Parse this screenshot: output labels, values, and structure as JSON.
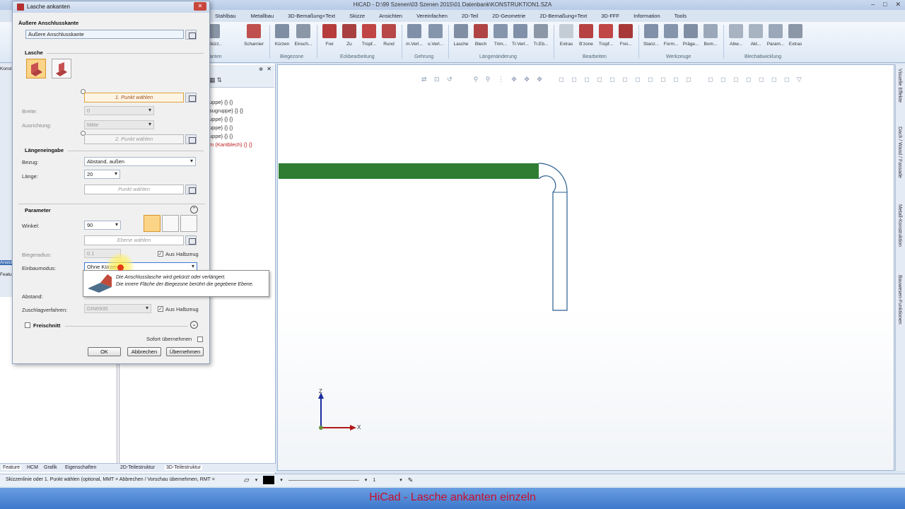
{
  "window": {
    "title": "HiCAD - D:\\99 Szenen\\03 Szenen 2015\\01 Datenbank\\KONSTRUKTION1.SZA",
    "controls": [
      "–",
      "□",
      "✕"
    ]
  },
  "ribbon": {
    "tabs": [
      "Stahlbau",
      "Metallbau",
      "3D-Bemaßung+Text",
      "Skizze",
      "Ansichten",
      "Vereinfachen",
      "2D-Teil",
      "2D-Geometrie",
      "2D-Bemaßung+Text",
      "3D-FFF",
      "Information",
      "Tools"
    ],
    "buttons": [
      "e.Skizz..",
      "Scharnier",
      "Kürzen",
      "Einsch...",
      "Frei",
      "Zu",
      "Tropf...",
      "Rund",
      "m.Verl...",
      "o.Verl...",
      "Lasche",
      "Blech",
      "Trim...",
      "Tr.Verl...",
      "Tr.Eb...",
      "Extras",
      "B'zone",
      "Tropf...",
      "Frei...",
      "Stanz...",
      "Form...",
      "Präge...",
      "Bom...",
      "Abw...",
      "Akt...",
      "Param...",
      "Extras"
    ],
    "groups": [
      "Biegezone",
      "Eckbearbeitung",
      "Gehrung",
      "Längenänderung",
      "Bearbeiten",
      "Werkzeuge",
      "Blechabwicklung"
    ],
    "partial_left": [
      "Gr",
      "anten"
    ]
  },
  "dialog": {
    "title": "Lasche ankanten",
    "sec_aussere": "Äußere Anschlusskante",
    "aussere_field": "Äußere Anschlusskante",
    "sec_lasche": "Lasche",
    "btn_punkt1": "1. Punkt wählen",
    "lbl_breite": "Breite:",
    "val_breite": "0",
    "lbl_ausrichtung": "Ausrichtung:",
    "val_ausrichtung": "Mitte",
    "btn_punkt2": "2. Punkt wählen",
    "sec_laengen": "Längeneingabe",
    "lbl_bezug": "Bezug:",
    "val_bezug": "Abstand, außen",
    "lbl_laenge": "Länge:",
    "val_laenge": "20",
    "btn_punkt": "Punkt wählen",
    "sec_parameter": "Parameter",
    "lbl_winkel": "Winkel:",
    "val_winkel": "90",
    "btn_ebene": "Ebene wählen",
    "lbl_biegeradius": "Biegeradius:",
    "val_biegeradius": "0.1",
    "chk_halbzeug1": "Aus Halbzeug",
    "lbl_einbaumodus": "Einbaumodus:",
    "val_einbaumodus": "Ohne Kürzen",
    "lbl_abstand": "Abstand:",
    "lbl_zuschlag": "Zuschlagverfahren:",
    "val_zuschlag": "DIN6935",
    "chk_halbzeug2": "Aus Halbzeug",
    "sec_freischnitt": "Freischnitt",
    "lbl_sofort": "Sofort übernehmen",
    "btn_ok": "OK",
    "btn_abbrechen": "Abbrechen",
    "btn_uebernehmen": "Übernehmen"
  },
  "tooltip": {
    "line1": "Die Anschlusslasche wird gekürzt oder verlängert.",
    "line2": "Die innere Fläche der Biegezone berührt die gegebene Ebene."
  },
  "tree": {
    "lines": [
      "uppe} {} {}",
      "sugruppe} {} {}",
      "uppe} {} {}",
      "uppe} {} {}",
      "uppe} {} {}",
      "m (Kantblech) {} {}"
    ]
  },
  "left_partial": [
    "Konst",
    "Ansich",
    "Featu"
  ],
  "bottom_tabs": [
    "Feature",
    "HCM",
    "Grafik",
    "Eigenschaften",
    "2D-Teilestruktur",
    "3D-Teilestruktur"
  ],
  "side_tabs": [
    "Visuelle Effekte",
    "Dach / Wand / Fassade",
    "Metall-Konstruktion",
    "Bauwesen-Funktionen"
  ],
  "axes": {
    "z": "Z",
    "x": "X"
  },
  "status": {
    "message": "Skizzenlinie oder 1. Punkt wählen (optional,  MMT = Abbrechen / Vorschau übernehmen, RMT =",
    "line_value": "1"
  },
  "caption": "HiCad - Lasche ankanten einzeln",
  "colors": {
    "flange_green": "#2e7d32",
    "sheet_outline": "#2a5d8f",
    "caption_red": "#c8102e",
    "axis_z": "#1a2ea0",
    "axis_x": "#b01818"
  }
}
